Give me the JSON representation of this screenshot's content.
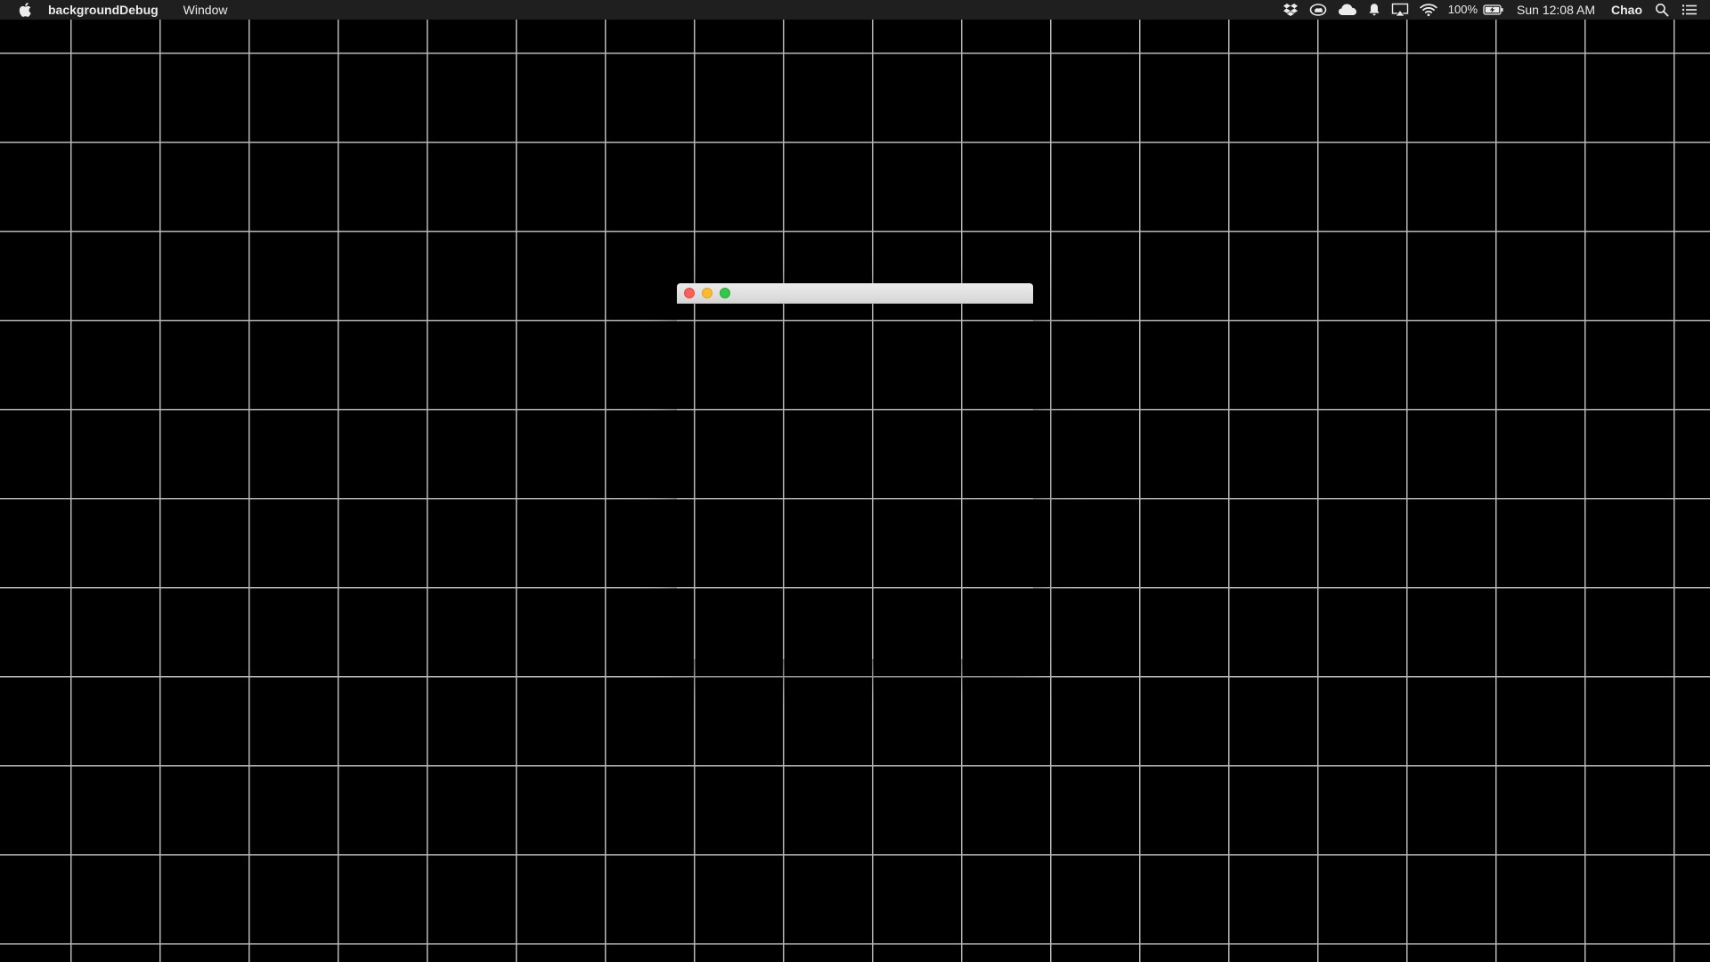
{
  "menubar": {
    "apple_icon": "apple-logo-icon",
    "app_name": "backgroundDebug",
    "menus": [
      "Window"
    ],
    "status": {
      "icons": [
        "dropbox-icon",
        "creative-cloud-icon",
        "cloud-icon",
        "notification-bell-icon",
        "airplay-icon",
        "wifi-icon"
      ],
      "battery_percent": "100%",
      "battery_icon": "battery-charging-icon",
      "clock": "Sun 12:08 AM",
      "user": "Chao",
      "search_icon": "spotlight-search-icon",
      "notification_center_icon": "notification-center-list-icon"
    },
    "colors": {
      "background": "#1f1f1f",
      "text": "#ececec"
    }
  },
  "desktop": {
    "background_color": "#000000",
    "grid_line_color": "#b9b9b9"
  },
  "window": {
    "title": "",
    "buttons": {
      "close_color": "#fc5f57",
      "minimize_color": "#fdbc2e",
      "zoom_color": "#33c748"
    },
    "content_background": "transparent"
  }
}
